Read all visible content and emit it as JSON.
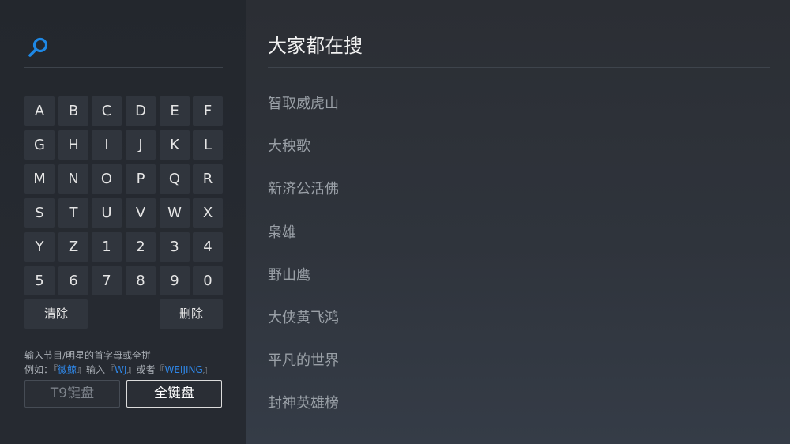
{
  "search": {
    "icon": "search-icon",
    "query": "",
    "accent_color": "#1e88e5"
  },
  "keyboard": {
    "rows": [
      [
        "A",
        "B",
        "C",
        "D",
        "E",
        "F"
      ],
      [
        "G",
        "H",
        "I",
        "J",
        "K",
        "L"
      ],
      [
        "M",
        "N",
        "O",
        "P",
        "Q",
        "R"
      ],
      [
        "S",
        "T",
        "U",
        "V",
        "W",
        "X"
      ],
      [
        "Y",
        "Z",
        "1",
        "2",
        "3",
        "4"
      ],
      [
        "5",
        "6",
        "7",
        "8",
        "9",
        "0"
      ]
    ],
    "clear_label": "清除",
    "delete_label": "删除"
  },
  "hint": {
    "line1": "输入节目/明星的首字母或全拼",
    "line2_prefix": "例如：『",
    "example_title": "微鲸",
    "line2_mid1": "』输入『",
    "example_short": "WJ",
    "line2_mid2": "』或者『",
    "example_full": "WEIJING",
    "line2_suffix": "』",
    "highlight_color": "#2f86e6"
  },
  "modes": {
    "t9_label": "T9键盘",
    "full_label": "全键盘",
    "selected": "full"
  },
  "trending": {
    "title": "大家都在搜",
    "items": [
      "智取威虎山",
      "大秧歌",
      "新济公活佛",
      "枭雄",
      "野山鹰",
      "大侠黄飞鸿",
      "平凡的世界",
      "封神英雄榜"
    ]
  }
}
